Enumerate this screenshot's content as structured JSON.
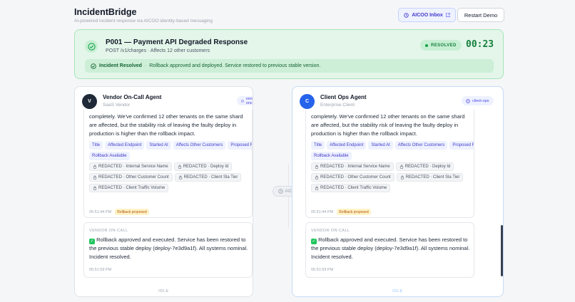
{
  "app": {
    "title": "IncidentBridge",
    "tagline": "AI-powered incident response via AICOO identity-based messaging",
    "inbox_label": "AICOO Inbox",
    "restart_label": "Restart Demo"
  },
  "incident": {
    "title": "P001 — Payment API Degraded Response",
    "subtitle": "POST /v1/charges · Affects 12 other customers",
    "status": "RESOLVED",
    "timer": "00:23",
    "resolved_label": "Incident Resolved",
    "resolved_sep": "·",
    "resolved_message": "Rollback approved and deployed. Service restored to previous stable version."
  },
  "hub_label": "AICOO",
  "panels": {
    "vendor": {
      "avatar": "V",
      "name": "Vendor On-Call Agent",
      "org": "SaaS Vendor",
      "chip": "vendor-oncall",
      "message1": "completely. We've confirmed 12 other tenants on the same shard are affected, but the stability risk of leaving the faulty deploy in production is higher than the rollback impact.",
      "tags": [
        "Title",
        "Affected Endpoint",
        "Started At",
        "Affects Other Customers",
        "Proposed Fix",
        "Rollback Available"
      ],
      "redacted": [
        "REDACTED · Internal Service Name",
        "REDACTED · Deploy Id",
        "REDACTED · Other Customer Count",
        "REDACTED · Client Sla Tier",
        "REDACTED · Client Traffic Volume"
      ],
      "time1": "05:51:44 PM",
      "rollback_chip": "Rollback proposed",
      "sender2": "VENDOR ON-CALL",
      "message2": "Rollback approved and executed. Service has been restored to the previous stable deploy (deploy-7e3d9a1f). All systems nominal. Incident resolved.",
      "time2": "05:51:59 PM",
      "status": "IDLE"
    },
    "client": {
      "avatar": "C",
      "name": "Client Ops Agent",
      "org": "Enterprise Client",
      "chip": "client-ops",
      "message1": "completely. We've confirmed 12 other tenants on the same shard are affected, but the stability risk of leaving the faulty deploy in production is higher than the rollback impact.",
      "tags": [
        "Title",
        "Affected Endpoint",
        "Started At",
        "Affects Other Customers",
        "Proposed Fix",
        "Rollback Available"
      ],
      "redacted": [
        "REDACTED · Internal Service Name",
        "REDACTED · Deploy Id",
        "REDACTED · Other Customer Count",
        "REDACTED · Client Sla Tier",
        "REDACTED · Client Traffic Volume"
      ],
      "time1": "05:51:44 PM",
      "rollback_chip": "Rollback proposed",
      "sender2": "VENDOR ON-CALL",
      "message2": "Rollback approved and executed. Service has been restored to the previous stable deploy (deploy-7e3d9a1f). All systems nominal. Incident resolved.",
      "time2": "05:51:59 PM",
      "status": "IDLE"
    }
  },
  "icons": {
    "inbox": "clock-icon",
    "external": "external-link-icon",
    "banner": "check-circle-icon",
    "lock": "lock-icon"
  },
  "colors": {
    "resolved_green": "#16a34a",
    "accent_indigo": "#4338ca",
    "client_avatar": "#2563eb",
    "vendor_avatar": "#1f2937"
  }
}
